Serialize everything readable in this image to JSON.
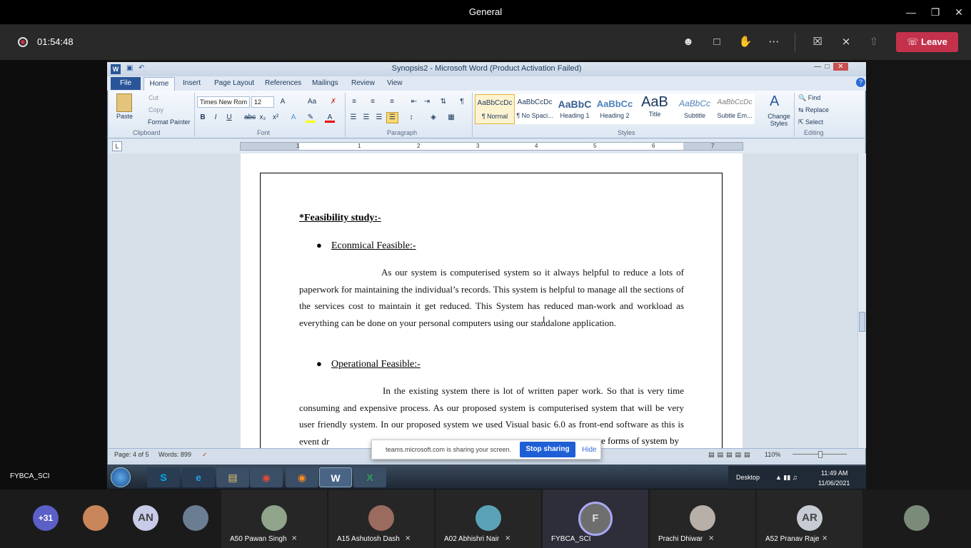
{
  "teams": {
    "window_title": "General",
    "timer": "01:54:48",
    "leave_label": "Leave",
    "presenter_label": "FYBCA_SCI",
    "colors": {
      "leave": "#c4314b",
      "record": "#c4314b"
    }
  },
  "word": {
    "title": "Synopsis2 - Microsoft Word (Product Activation Failed)",
    "tabs": [
      "File",
      "Home",
      "Insert",
      "Page Layout",
      "References",
      "Mailings",
      "Review",
      "View"
    ],
    "clipboard": {
      "paste": "Paste",
      "cut": "Cut",
      "copy": "Copy",
      "format_painter": "Format Painter",
      "group": "Clipboard"
    },
    "font": {
      "name": "Times New Rom",
      "size": "12",
      "group": "Font"
    },
    "paragraph_group": "Paragraph",
    "styles": [
      {
        "sample": "AaBbCcDc",
        "name": "¶ Normal"
      },
      {
        "sample": "AaBbCcDc",
        "name": "¶ No Spaci..."
      },
      {
        "sample": "AaBbC",
        "name": "Heading 1"
      },
      {
        "sample": "AaBbCc",
        "name": "Heading 2"
      },
      {
        "sample": "AaB",
        "name": "Title"
      },
      {
        "sample": "AaBbCc",
        "name": "Subtitle"
      },
      {
        "sample": "AaBbCcDc",
        "name": "Subtle Em..."
      }
    ],
    "change_styles": "Change Styles",
    "styles_group": "Styles",
    "editing": {
      "find": "Find",
      "replace": "Replace",
      "select": "Select",
      "group": "Editing"
    },
    "ruler_numbers": [
      "1",
      "1",
      "2",
      "3",
      "4",
      "5",
      "6",
      "7"
    ],
    "document": {
      "heading": "*Feasibility study:-",
      "sections": [
        {
          "title": "Econmical Feasible:-",
          "body": "As our system is computerised system so it always helpful to reduce a lots of paperwork for maintaining the individual’s records. This system is helpful to manage all the sections of the services cost to maintain it get reduced. This System has reduced man-work and workload as everything can be done on your personal computers using our standalone application."
        },
        {
          "title": "Operational Feasible:-",
          "body": "In the existing system there is lot of written paper work. So that is very time consuming and expensive process. As  our proposed system is computerised system that will be very user friendly system. In our proposed system we used Visual basic 6.0 as front-end software as this is event dr"
        }
      ],
      "body_tail": "e forms of system by"
    },
    "status": {
      "page": "Page: 4 of 5",
      "words": "Words: 899",
      "zoom": "110%"
    }
  },
  "share_bar": {
    "text": "teams.microsoft.com is sharing your screen.",
    "stop": "Stop sharing",
    "hide": "Hide"
  },
  "taskbar": {
    "desktop": "Desktop",
    "time": "11:49 AM",
    "date": "11/06/2021"
  },
  "participants": {
    "overflow": "+31",
    "avatars": [
      {
        "initials": "AN"
      }
    ],
    "tiles": [
      {
        "name": "A50 Pawan Singh"
      },
      {
        "name": "A15 Ashutosh Dash"
      },
      {
        "name": "A02 Abhishri Nair"
      },
      {
        "name": "FYBCA_SCI",
        "initials": "F"
      },
      {
        "name": "Prachi Dhiwar"
      },
      {
        "name": "A52 Pranav Raje",
        "initials": "AR"
      }
    ]
  }
}
